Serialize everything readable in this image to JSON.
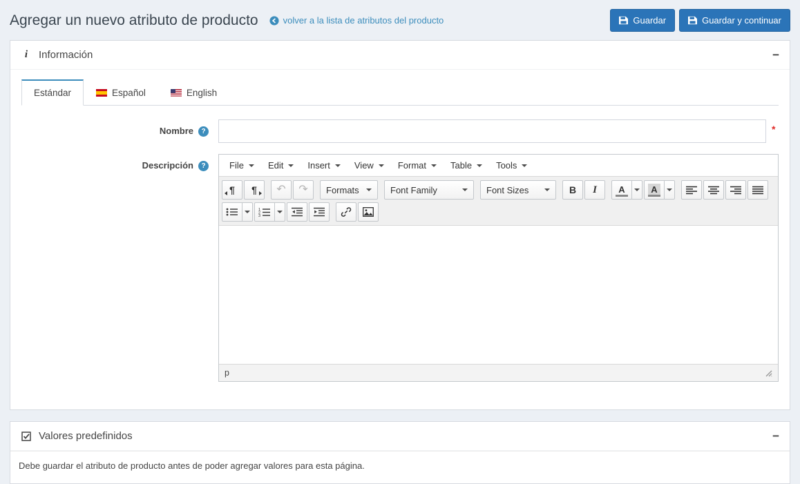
{
  "header": {
    "title": "Agregar un nuevo atributo de producto",
    "back_link": "volver a la lista de atributos del producto",
    "save_button": "Guardar",
    "save_continue_button": "Guardar y continuar"
  },
  "icons": {
    "info": "i",
    "minus": "−",
    "help": "?",
    "pilcrow": "¶",
    "undo": "↶",
    "redo": "↷"
  },
  "info_panel": {
    "title": "Información",
    "tabs": [
      {
        "label": "Estándar",
        "flag": "none"
      },
      {
        "label": "Español",
        "flag": "spain"
      },
      {
        "label": "English",
        "flag": "usa"
      }
    ],
    "fields": {
      "nombre_label": "Nombre",
      "descripcion_label": "Descripción",
      "nombre_value": "",
      "required_marker": "*"
    },
    "editor": {
      "menus": [
        "File",
        "Edit",
        "Insert",
        "View",
        "Format",
        "Table",
        "Tools"
      ],
      "formats_label": "Formats",
      "font_family_label": "Font Family",
      "font_sizes_label": "Font Sizes",
      "bold_label": "B",
      "italic_label": "I",
      "forecolor_label": "A",
      "backcolor_label": "A",
      "status_path": "p",
      "content": ""
    }
  },
  "values_panel": {
    "title": "Valores predefinidos",
    "body_text": "Debe guardar el atributo de producto antes de poder agregar valores para esta página."
  },
  "colors": {
    "accent_blue": "#3c8dbc",
    "button_blue": "#2b74b8",
    "required_red": "#e02b27"
  }
}
